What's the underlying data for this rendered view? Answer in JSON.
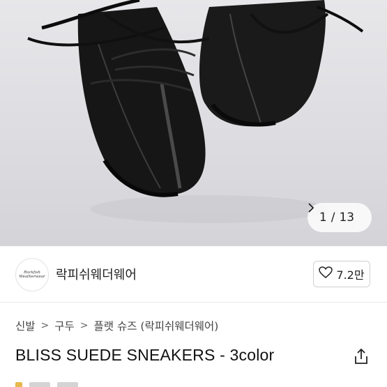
{
  "gallery": {
    "counter_current": "1",
    "counter_separator": "/",
    "counter_total": "13",
    "next_icon": "chevron-right-icon"
  },
  "brand": {
    "logo_line1": "Rockfish",
    "logo_line2": "Weatherwear",
    "name": "락피쉬웨더웨어",
    "like_icon": "heart-outline-icon",
    "like_count": "7.2만"
  },
  "breadcrumb": {
    "items": [
      "신발",
      "구두",
      "플랫 슈즈 (락피쉬웨더웨어)"
    ],
    "separator": ">"
  },
  "product": {
    "title": "BLISS SUEDE SNEAKERS - 3color",
    "share_icon": "share-icon"
  },
  "colors": {
    "accent_star": "#e7b84a",
    "background_image": "#dedee2"
  }
}
